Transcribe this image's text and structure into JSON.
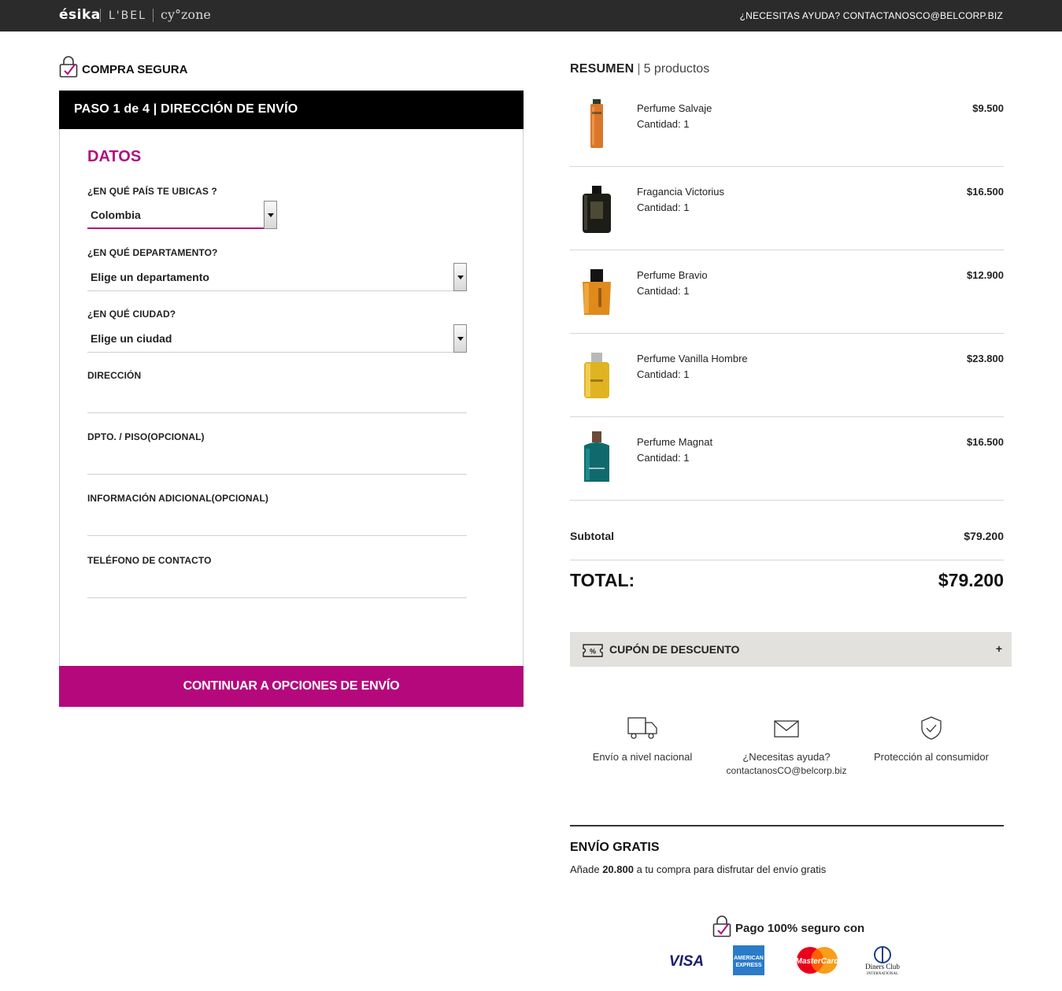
{
  "topbar": {
    "brands": [
      "ésika",
      "L'BEL",
      "cy°zone"
    ],
    "help_text": "¿NECESITAS AYUDA? CONTACTANOSCO@BELCORP.BIZ"
  },
  "secure": {
    "title": "COMPRA SEGURA",
    "icon": "lock-check-icon"
  },
  "step": {
    "label": "PASO 1 de 4 | DIRECCIÓN DE ENVÍO"
  },
  "form": {
    "section_title": "DATOS",
    "country": {
      "label": "¿EN QUÉ PAÍS TE UBICAS ?",
      "value": "Colombia"
    },
    "department": {
      "label": "¿EN QUÉ DEPARTAMENTO?",
      "value": "Elige un departamento"
    },
    "city": {
      "label": "¿EN QUÉ CIUDAD?",
      "value": "Elige un ciudad"
    },
    "address": {
      "label": "DIRECCIÓN",
      "value": ""
    },
    "floor": {
      "label": "DPTO. / PISO(OPCIONAL)",
      "value": ""
    },
    "extra": {
      "label": "INFORMACIÓN ADICIONAL(OPCIONAL)",
      "value": ""
    },
    "phone": {
      "label": "TELÉFONO DE CONTACTO",
      "value": ""
    },
    "submit_label": "CONTINUAR A OPCIONES DE ENVÍO"
  },
  "summary": {
    "title": "RESUMEN",
    "count_text": "5 productos",
    "products": [
      {
        "name": "Perfume Salvaje",
        "qty": "Cantidad: 1",
        "price": "$9.500",
        "color": "#d9772a"
      },
      {
        "name": "Fragancia Victorius",
        "qty": "Cantidad: 1",
        "price": "$16.500",
        "color": "#2c2c24"
      },
      {
        "name": "Perfume Bravio",
        "qty": "Cantidad: 1",
        "price": "$12.900",
        "color": "#e08a1c"
      },
      {
        "name": "Perfume Vanilla Hombre",
        "qty": "Cantidad: 1",
        "price": "$23.800",
        "color": "#e0b322"
      },
      {
        "name": "Perfume Magnat",
        "qty": "Cantidad: 1",
        "price": "$16.500",
        "color": "#0f6a6e"
      }
    ],
    "subtotal_label": "Subtotal",
    "subtotal_value": "$79.200",
    "total_label": "TOTAL:",
    "total_value": "$79.200"
  },
  "coupon": {
    "label": "CUPÓN DE DESCUENTO",
    "toggle": "+",
    "icon": "coupon-icon"
  },
  "features": [
    {
      "icon": "truck-icon",
      "line1": "Envío a nivel nacional",
      "line2": ""
    },
    {
      "icon": "mail-icon",
      "line1": "¿Necesitas ayuda?",
      "line2": "contactanosCO@belcorp.biz"
    },
    {
      "icon": "shield-check-icon",
      "line1": "Protección al consumidor",
      "line2": ""
    }
  ],
  "free_shipping": {
    "title": "ENVÍO GRATIS",
    "prefix": "Añade ",
    "amount": "20.800",
    "suffix": " a tu compra para disfrutar del envío gratis"
  },
  "payment": {
    "title": "Pago 100% seguro con",
    "cards": [
      "VISA",
      "AMERICAN EXPRESS",
      "MasterCard",
      "Diners Club INTERNATIONAL"
    ]
  },
  "colors": {
    "accent": "#b5087c",
    "topbar": "#2b2b2b",
    "coupon_bg": "#e3e1dd"
  }
}
